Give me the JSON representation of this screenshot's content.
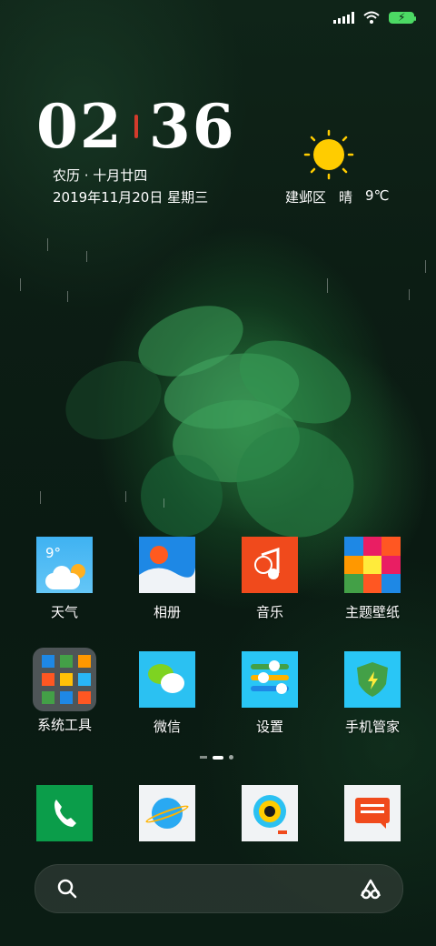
{
  "status_bar": {
    "signal_icon": "signal-icon",
    "wifi_icon": "wifi-icon",
    "battery_icon": "battery-charging-icon"
  },
  "clock": {
    "hours": "02",
    "minutes": "36",
    "lunar": "农历 · 十月廿四",
    "date": "2019年11月20日  星期三"
  },
  "weather": {
    "icon": "sun-icon",
    "location": "建邺区",
    "condition": "晴",
    "temperature": "9℃"
  },
  "weather_app_icon": {
    "temperature": "9°"
  },
  "apps_row1": [
    {
      "label": "天气",
      "icon": "weather-app-icon"
    },
    {
      "label": "相册",
      "icon": "gallery-app-icon"
    },
    {
      "label": "音乐",
      "icon": "music-app-icon"
    },
    {
      "label": "主题壁纸",
      "icon": "themes-app-icon"
    }
  ],
  "apps_row2": [
    {
      "label": "系统工具",
      "icon": "system-tools-folder-icon"
    },
    {
      "label": "微信",
      "icon": "wechat-app-icon"
    },
    {
      "label": "设置",
      "icon": "settings-app-icon"
    },
    {
      "label": "手机管家",
      "icon": "security-app-icon"
    }
  ],
  "dock": [
    {
      "icon": "phone-app-icon"
    },
    {
      "icon": "browser-app-icon"
    },
    {
      "icon": "camera-app-icon"
    },
    {
      "icon": "messages-app-icon"
    }
  ],
  "search_bar": {
    "search_icon": "search-icon",
    "assistant_icon": "assistant-icon"
  },
  "colors": {
    "accent_red": "#d23b2c",
    "battery_green": "#4cd964",
    "sun_yellow": "#ffcc00"
  }
}
